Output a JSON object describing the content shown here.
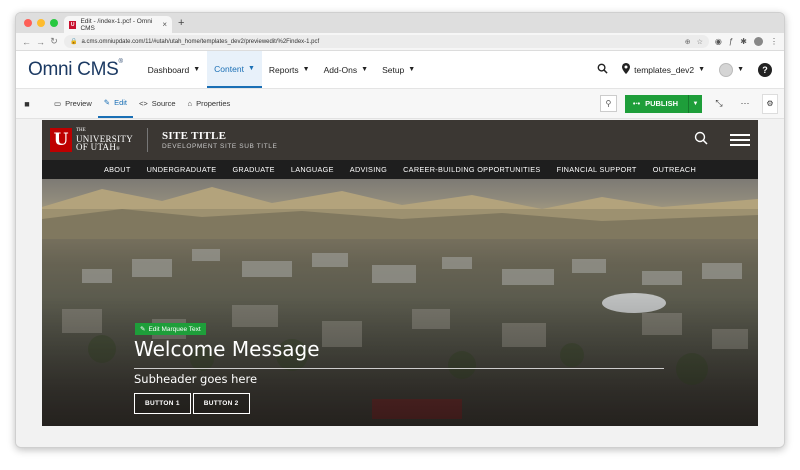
{
  "browser": {
    "tab_title": "Edit - /index-1.pcf - Omni CMS",
    "tab_favicon": "U",
    "url": "a.cms.omniupdate.com/11/#utah/utah_home/templates_dev2/previewedit/%2Findex-1.pcf",
    "traffic_colors": [
      "#fe5f57",
      "#febc2e",
      "#28c840"
    ]
  },
  "cms": {
    "logo": "Omni CMS",
    "menu": [
      {
        "label": "Dashboard",
        "active": false
      },
      {
        "label": "Content",
        "active": true
      },
      {
        "label": "Reports",
        "active": false
      },
      {
        "label": "Add-Ons",
        "active": false
      },
      {
        "label": "Setup",
        "active": false
      }
    ],
    "site_selector": "templates_dev2",
    "help": "?"
  },
  "toolbar": {
    "modes": [
      {
        "label": "Preview",
        "icon": "monitor-icon"
      },
      {
        "label": "Edit",
        "icon": "pencil-icon",
        "active": true
      },
      {
        "label": "Source",
        "icon": "code-icon"
      },
      {
        "label": "Properties",
        "icon": "properties-icon"
      }
    ],
    "publish_label": "PUBLISH",
    "accent": "#1e9e3a"
  },
  "site": {
    "logo_small": "THE",
    "logo_line1": "UNIVERSITY",
    "logo_line2": "OF UTAH",
    "logo_reg": "®",
    "title": "SITE TITLE",
    "subtitle": "DEVELOPMENT SITE SUB TITLE",
    "menu": [
      "ABOUT",
      "UNDERGRADUATE",
      "GRADUATE",
      "LANGUAGE",
      "ADVISING",
      "CAREER-BUILDING OPPORTUNITIES",
      "FINANCIAL SUPPORT",
      "OUTREACH"
    ],
    "brand_red": "#be0000"
  },
  "hero": {
    "edit_marquee": "Edit Marquee Text",
    "welcome": "Welcome Message",
    "subheader": "Subheader goes here",
    "button1": "BUTTON 1",
    "button2": "BUTTON 2"
  }
}
